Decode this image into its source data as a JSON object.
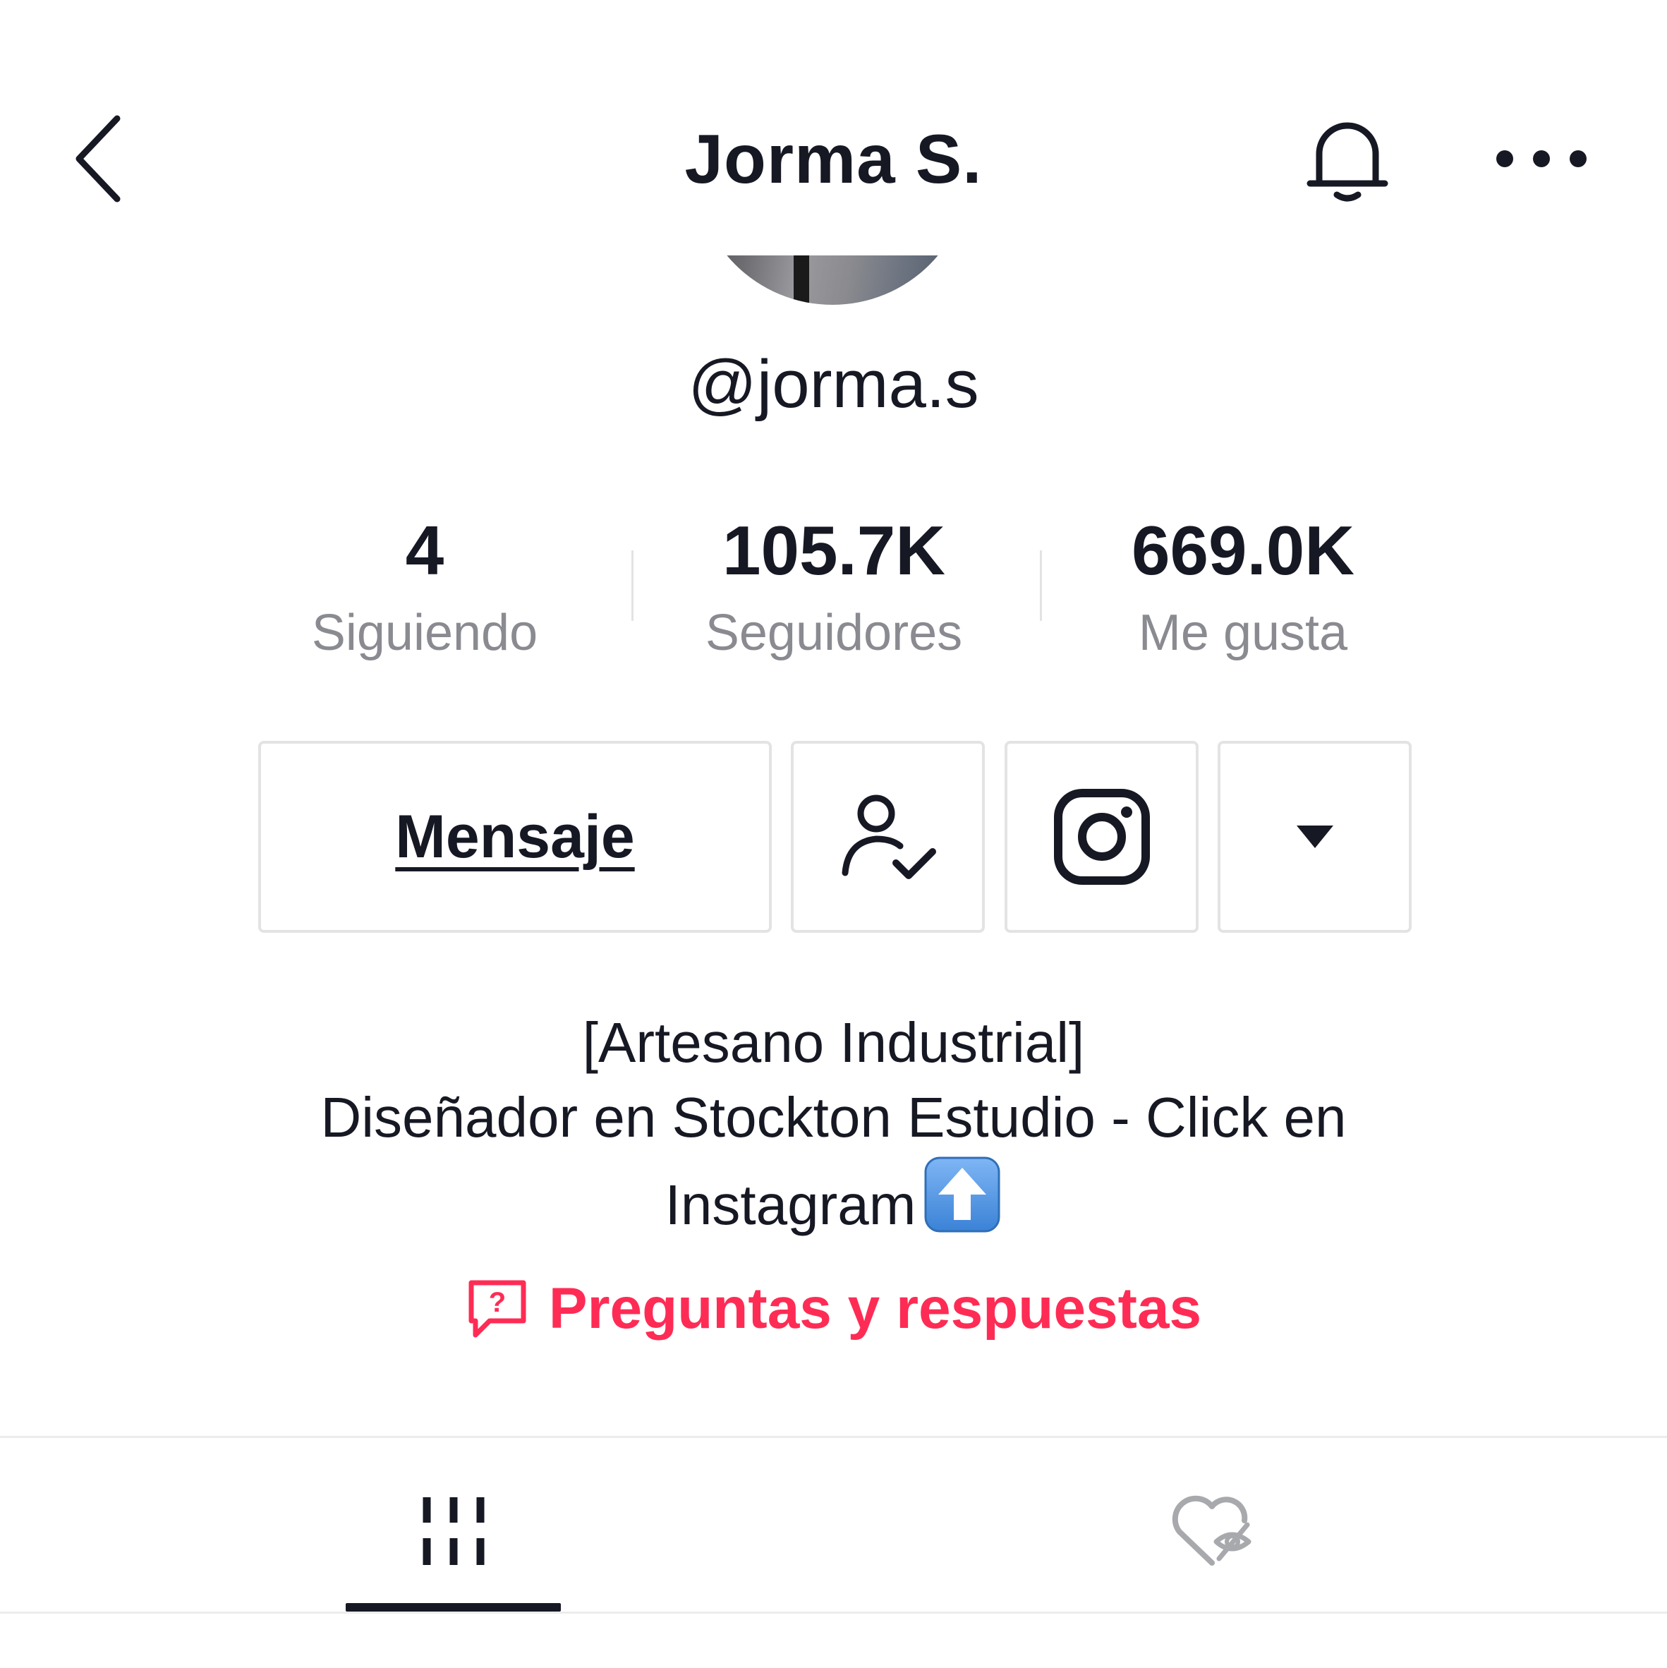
{
  "header": {
    "title": "Jorma S.",
    "back_icon": "chevron-left-icon",
    "bell_icon": "bell-icon",
    "more_icon": "more-horizontal-icon"
  },
  "profile": {
    "username": "@jorma.s",
    "avatar": "avatar-photo"
  },
  "stats": [
    {
      "value": "4",
      "label": "Siguiendo"
    },
    {
      "value": "105.7K",
      "label": "Seguidores"
    },
    {
      "value": "669.0K",
      "label": "Me gusta"
    }
  ],
  "actions": {
    "message_label": "Mensaje",
    "follow_icon": "user-check-icon",
    "instagram_icon": "instagram-icon",
    "more_icon": "caret-down-icon"
  },
  "bio": {
    "line1": "[Artesano Industrial]",
    "line2": "Diseñador en Stockton Estudio - Click en",
    "line3": "Instagram",
    "emoji": "up-arrow-emoji"
  },
  "qa": {
    "label": "Preguntas y respuestas",
    "icon": "question-bubble-icon"
  },
  "tabs": [
    {
      "name": "videos",
      "icon": "grid-icon",
      "active": true
    },
    {
      "name": "liked",
      "icon": "hidden-heart-icon",
      "active": false
    }
  ],
  "colors": {
    "accent": "#fe2c55",
    "text": "#161823",
    "muted": "#8a8b91",
    "border": "#e3e3e4"
  }
}
